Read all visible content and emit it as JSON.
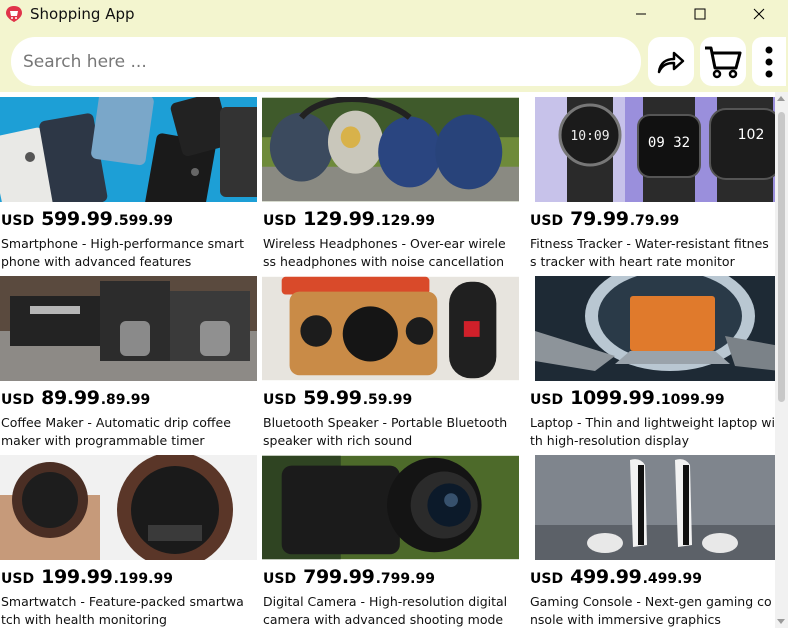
{
  "window": {
    "title": "Shopping App",
    "colors": {
      "titlebar_bg": "#f3f5cf",
      "app_icon": "#e0344a"
    }
  },
  "toolbar": {
    "search_placeholder": "Search here ...",
    "icons": [
      "share-icon",
      "cart-icon",
      "more-vertical-icon"
    ]
  },
  "products": [
    {
      "currency": "USD",
      "price_main": "599.99",
      "price_small": ".599.99",
      "description": "Smartphone - High-performance smartphone with advanced features"
    },
    {
      "currency": "USD",
      "price_main": "129.99",
      "price_small": ".129.99",
      "description": "Wireless Headphones - Over-ear wireless headphones with noise cancellation"
    },
    {
      "currency": "USD",
      "price_main": "79.99",
      "price_small": ".79.99",
      "description": "Fitness Tracker - Water-resistant fitness tracker with heart rate monitor"
    },
    {
      "currency": "USD",
      "price_main": "89.99",
      "price_small": ".89.99",
      "description": "Coffee Maker - Automatic drip coffee maker with programmable timer"
    },
    {
      "currency": "USD",
      "price_main": "59.99",
      "price_small": ".59.99",
      "description": "Bluetooth Speaker - Portable Bluetooth speaker with rich sound"
    },
    {
      "currency": "USD",
      "price_main": "1099.99",
      "price_small": ".1099.99",
      "description": "Laptop - Thin and lightweight laptop with high-resolution display"
    },
    {
      "currency": "USD",
      "price_main": "199.99",
      "price_small": ".199.99",
      "description": "Smartwatch - Feature-packed smartwatch with health monitoring"
    },
    {
      "currency": "USD",
      "price_main": "799.99",
      "price_small": ".799.99",
      "description": "Digital Camera - High-resolution digital camera with advanced shooting modes"
    },
    {
      "currency": "USD",
      "price_main": "499.99",
      "price_small": ".499.99",
      "description": "Gaming Console - Next-gen gaming console with immersive graphics"
    }
  ],
  "watch_faces": {
    "a": "10:09",
    "b": "09 32",
    "c": "102"
  }
}
